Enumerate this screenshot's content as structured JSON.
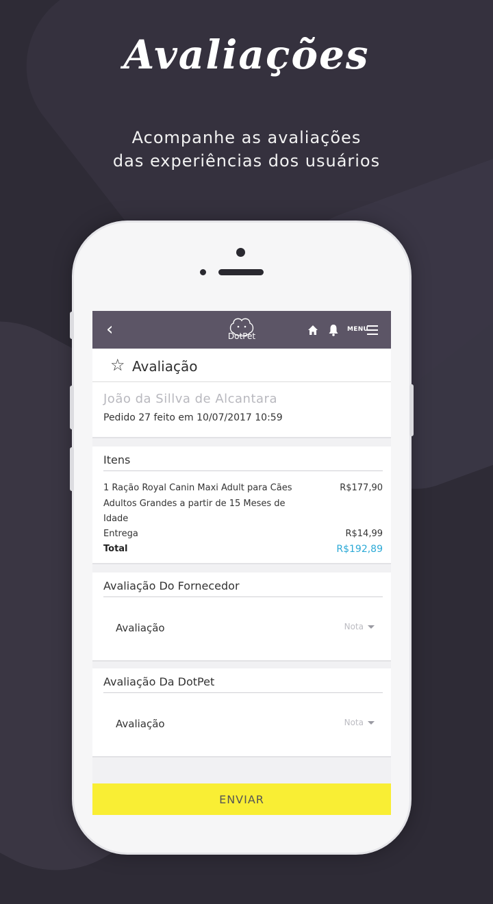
{
  "promo": {
    "headline": "Avaliações",
    "subline_1": "Acompanhe as avaliações",
    "subline_2": "das experiências dos usuários"
  },
  "app": {
    "logo_text": "DotPet",
    "menu_label": "MENU",
    "icons": [
      "back-icon",
      "dotpet-logo-icon",
      "home-icon",
      "bell-icon",
      "menu-icon",
      "star-icon",
      "chevron-down-icon"
    ]
  },
  "page": {
    "title": "Avaliação"
  },
  "order": {
    "customer_name": "João da Sillva de Alcantara",
    "order_line": "Pedido 27 feito em 10/07/2017 10:59"
  },
  "items": {
    "heading": "Itens",
    "rows": [
      {
        "description": "1 Ração Royal Canin Maxi Adult para Cães Adultos Grandes a partir de 15 Meses de Idade",
        "price": "R$177,90"
      }
    ],
    "delivery_label": "Entrega",
    "delivery_value": "R$14,99",
    "total_label": "Total",
    "total_value": "R$192,89"
  },
  "ratings": {
    "supplier": {
      "heading": "Avaliação Do Fornecedor",
      "label": "Avaliação",
      "select_placeholder": "Nota"
    },
    "dotpet": {
      "heading": "Avaliação Da DotPet",
      "label": "Avaliação",
      "select_placeholder": "Nota"
    }
  },
  "actions": {
    "send_label": "ENVIAR"
  },
  "colors": {
    "background": "#2e2b36",
    "topbar": "#5c5566",
    "total_accent": "#2ba9d6",
    "send_button": "#f9ee34"
  }
}
